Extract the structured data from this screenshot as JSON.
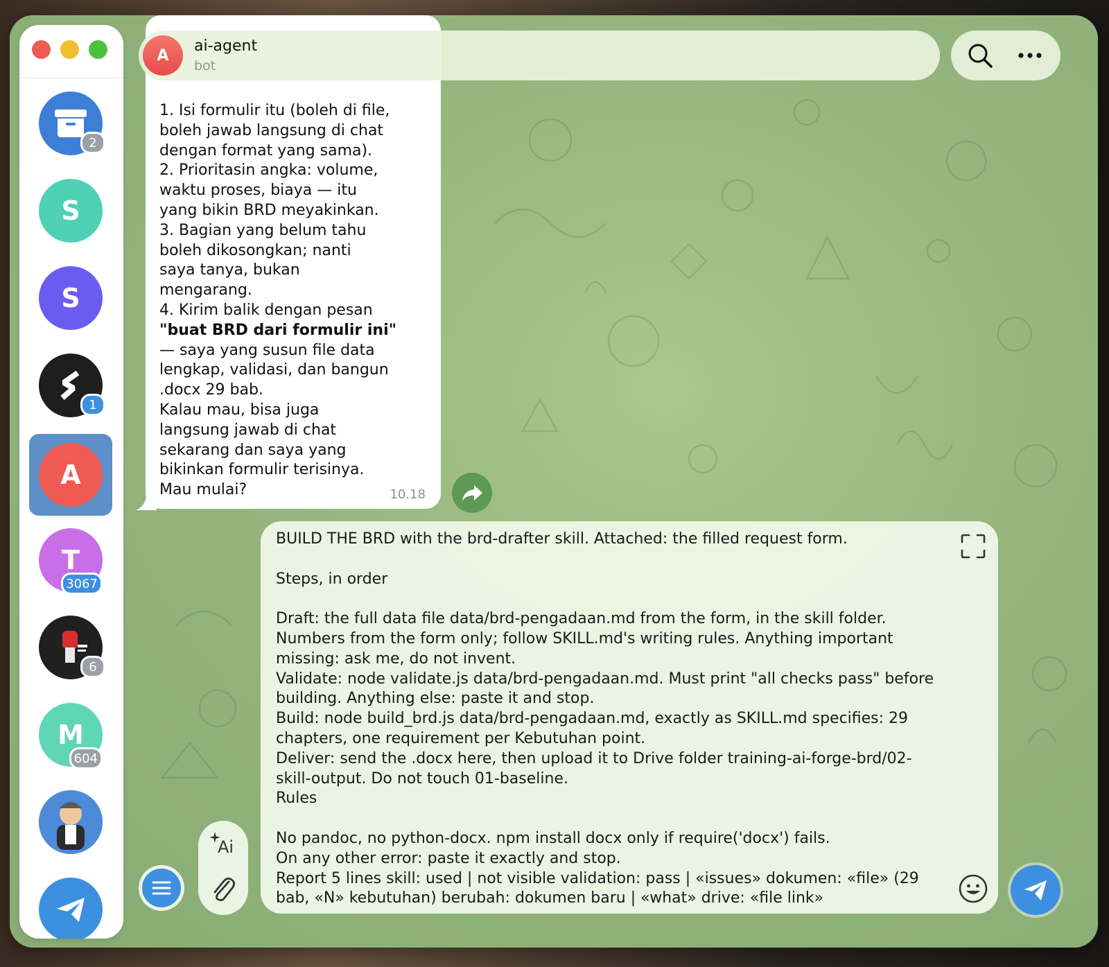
{
  "window": {
    "traffic_lights": [
      "close",
      "minimize",
      "zoom"
    ]
  },
  "sidebar": {
    "items": [
      {
        "name": "archive",
        "letter": "",
        "icon": "archive-icon",
        "color": "#3d7fd6",
        "badge": "2",
        "badge_color": "#9aa0a6"
      },
      {
        "name": "chat-s-teal",
        "letter": "S",
        "color": "#4fd1b6",
        "badge": "",
        "badge_color": ""
      },
      {
        "name": "chat-s-purple",
        "letter": "S",
        "color": "#6a5cf0",
        "badge": "",
        "badge_color": ""
      },
      {
        "name": "chat-logo-black",
        "letter": "",
        "icon": "stripe-logo-icon",
        "color": "#1e1e1e",
        "badge": "1",
        "badge_color": "#3d8fe0"
      },
      {
        "name": "chat-ai-agent",
        "letter": "A",
        "color": "#ef5a52",
        "badge": "",
        "badge_color": "",
        "active": true
      },
      {
        "name": "chat-t",
        "letter": "T",
        "color": "#c86fe8",
        "badge": "3067",
        "badge_color": "#3d8fe0"
      },
      {
        "name": "chat-fist",
        "letter": "",
        "icon": "fist-image-icon",
        "color": "#202020",
        "badge": "6",
        "badge_color": "#9aa0a6"
      },
      {
        "name": "chat-m",
        "letter": "M",
        "color": "#5fd6b4",
        "badge": "604",
        "badge_color": "#9aa0a6"
      },
      {
        "name": "chat-cartoon",
        "letter": "",
        "icon": "cartoon-avatar-icon",
        "color": "#3a72c4",
        "badge": "",
        "badge_color": ""
      },
      {
        "name": "telegram",
        "letter": "",
        "icon": "telegram-icon",
        "color": "#3d8fe0",
        "badge": "",
        "badge_color": ""
      }
    ]
  },
  "header": {
    "avatar_letter": "A",
    "title": "ai-agent",
    "subtitle": "bot"
  },
  "incoming_message": {
    "text_lines": [
      "1. Isi formulir itu (boleh di file,",
      "boleh jawab langsung di chat",
      "dengan format yang sama).",
      "2. Prioritasin angka: volume,",
      "waktu proses, biaya — itu",
      "yang bikin BRD meyakinkan.",
      "3. Bagian yang belum tahu",
      "boleh dikosongkan; nanti",
      "saya tanya, bukan",
      "mengarang.",
      "4. Kirim balik dengan pesan"
    ],
    "bold_line": "\"buat BRD dari formulir ini\"",
    "text_lines_after": [
      "— saya yang susun file data",
      "lengkap, validasi, dan bangun",
      ".docx 29 bab.",
      "Kalau mau, bisa juga",
      "langsung jawab di chat",
      "sekarang dan saya yang",
      "bikinkan formulir terisinya.",
      "Mau mulai?"
    ],
    "time": "10.18"
  },
  "composer": {
    "text": "BUILD THE BRD with the brd-drafter skill. Attached: the filled request form.\n\nSteps, in order\n\nDraft: the full data file data/brd-pengadaan.md from the form, in the skill folder.\nNumbers from the form only; follow SKILL.md's writing rules. Anything important\nmissing: ask me, do not invent.\nValidate: node validate.js data/brd-pengadaan.md. Must print \"all checks pass\" before\nbuilding. Anything else: paste it and stop.\nBuild: node build_brd.js data/brd-pengadaan.md, exactly as SKILL.md specifies: 29\nchapters, one requirement per Kebutuhan point.\nDeliver: send the .docx here, then upload it to Drive folder training-ai-forge-brd/02-\nskill-output. Do not touch 01-baseline.\nRules\n\nNo pandoc, no python-docx. npm install docx only if require('docx') fails.\nOn any other error: paste it exactly and stop.\nReport 5 lines skill: used | not visible validation: pass | «issues» dokumen: «file» (29\nbab, «N» kebutuhan) berubah: dokumen baru | «what» drive: «file link»"
  },
  "tools": {
    "ai_label": "Ai"
  },
  "colors": {
    "accent": "#3d8fe0",
    "bubble_in": "#ffffff",
    "forward": "#5c9a54"
  }
}
